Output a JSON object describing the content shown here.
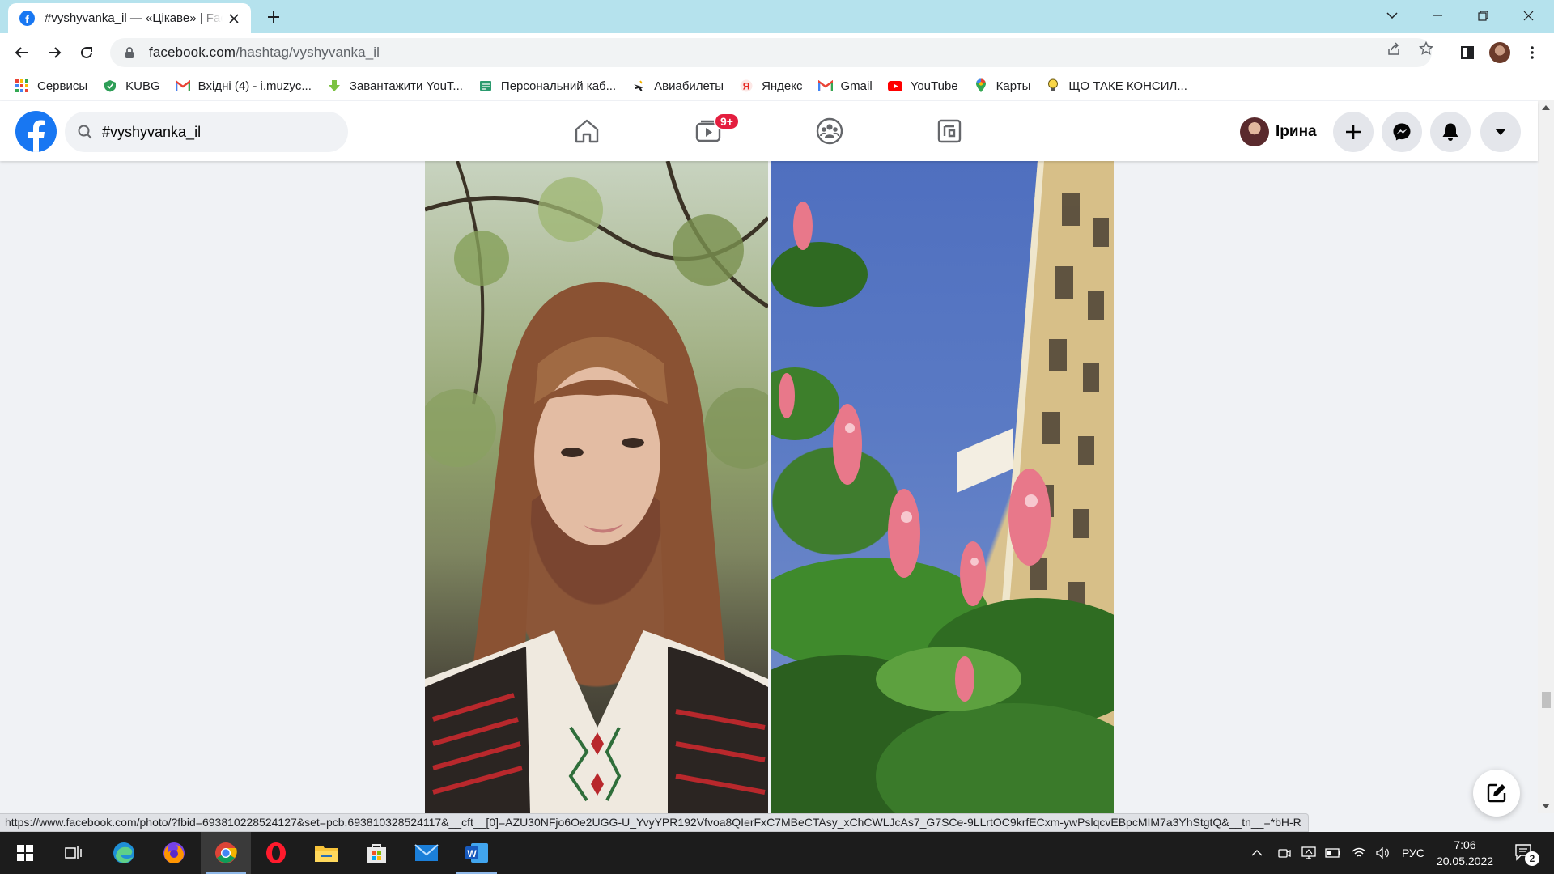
{
  "browser": {
    "tab_title": "#vyshyvanka_il — «Цікаве» | Facebook",
    "url_host": "facebook.com",
    "url_path": "/hashtag/vyshyvanka_il"
  },
  "bookmarks": [
    {
      "label": "Сервисы",
      "icon": "apps-grid-icon"
    },
    {
      "label": "KUBG",
      "icon": "kubg-icon"
    },
    {
      "label": "Вхідні (4) - i.muzyc...",
      "icon": "gmail-icon"
    },
    {
      "label": "Завантажити YouT...",
      "icon": "download-arrow-icon"
    },
    {
      "label": "Персональний каб...",
      "icon": "cabinet-icon"
    },
    {
      "label": "Авиабилеты",
      "icon": "plane-icon"
    },
    {
      "label": "Яндекс",
      "icon": "yandex-icon"
    },
    {
      "label": "Gmail",
      "icon": "gmail-icon"
    },
    {
      "label": "YouTube",
      "icon": "youtube-icon"
    },
    {
      "label": "Карты",
      "icon": "maps-pin-icon"
    },
    {
      "label": "ЩО ТАКЕ КОНСИЛ...",
      "icon": "lightbulb-icon"
    }
  ],
  "facebook": {
    "search_value": "#vyshyvanka_il",
    "watch_badge": "9+",
    "profile_name": "Ірина"
  },
  "status_url": "https://www.facebook.com/photo/?fbid=693810228524127&set=pcb.693810328524117&__cft__[0]=AZU30NFjo6Oe2UGG-U_YvyYPR192Vfvoa8QIerFxC7MBeCTAsy_xChCWLJcAs7_G7SCe-9LLrtOC9krfECxm-ywPslqcvEBpcMIM7a3YhStgtQ&__tn__=*bH-R",
  "taskbar": {
    "lang": "РУС",
    "time": "7:06",
    "date": "20.05.2022",
    "notif_count": "2"
  },
  "colors": {
    "fb_blue": "#1877f2",
    "tab_strip": "#b5e2ed",
    "badge_red": "#e41e3f"
  }
}
